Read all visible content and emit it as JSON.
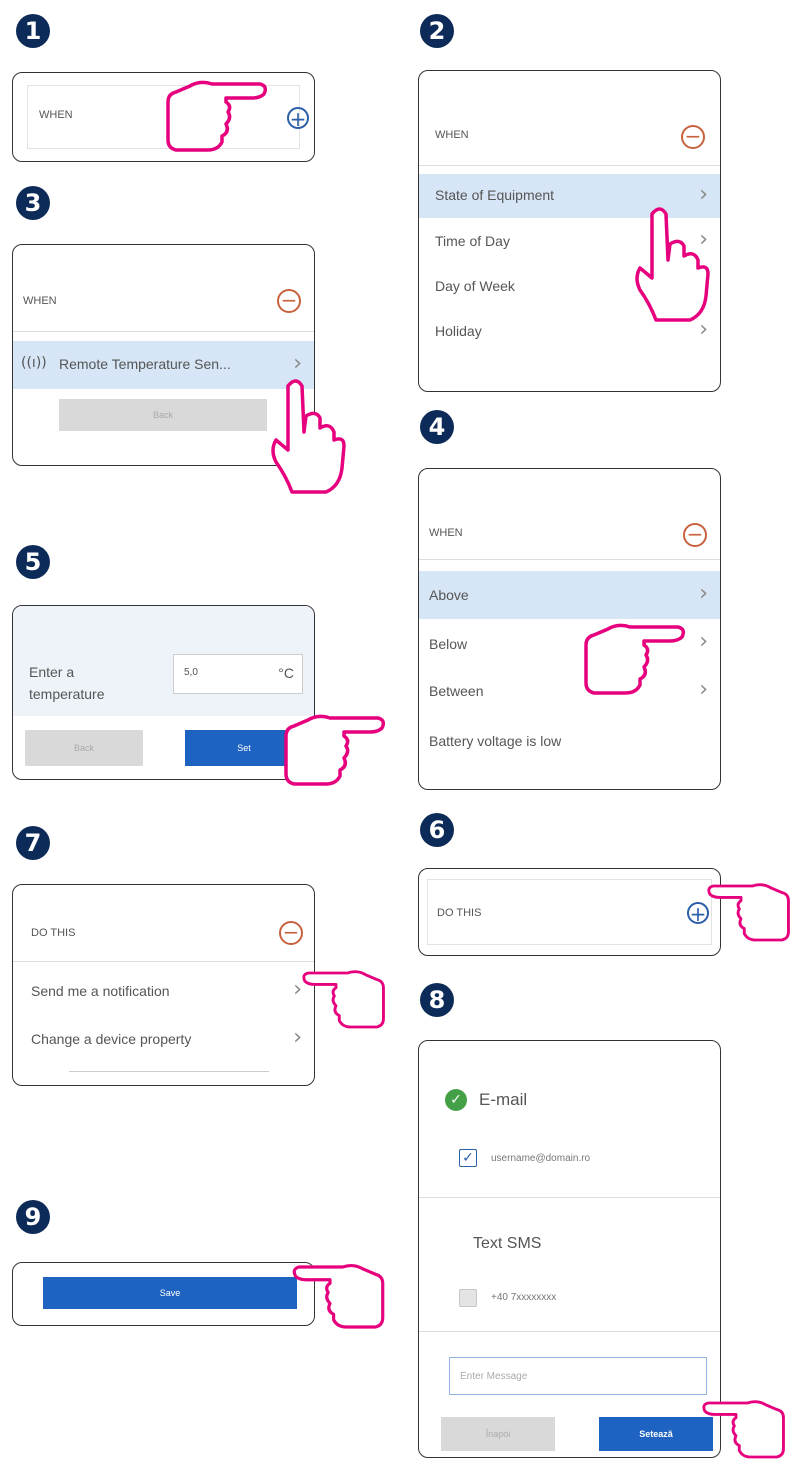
{
  "steps": [
    "1",
    "2",
    "3",
    "4",
    "5",
    "6",
    "7",
    "8",
    "9"
  ],
  "p1": {
    "when": "WHEN"
  },
  "p2": {
    "when": "WHEN",
    "items": [
      "State of Equipment",
      "Time of Day",
      "Day of Week",
      "Holiday"
    ]
  },
  "p3": {
    "when": "WHEN",
    "sensor": "Remote Temperature Sen...",
    "back": "Back"
  },
  "p4": {
    "when": "WHEN",
    "items": [
      "Above",
      "Below",
      "Between",
      "Battery voltage is low"
    ]
  },
  "p5": {
    "label_line1": "Enter a",
    "label_line2": "temperature",
    "value": "5,0",
    "unit": "°C",
    "back": "Back",
    "set": "Set"
  },
  "p6": {
    "do_this": "DO THIS"
  },
  "p7": {
    "do_this": "DO THIS",
    "items": [
      "Send me a notification",
      "Change a device property"
    ]
  },
  "p8": {
    "email_label": "E-mail",
    "email_value": "username@domain.ro",
    "sms_label": "Text SMS",
    "sms_value": "+40 7xxxxxxxx",
    "message_placeholder": "Enter Message",
    "back": "Înapoi",
    "set": "Setează"
  },
  "p9": {
    "save": "Save"
  },
  "colors": {
    "accent_blue": "#1e63c1",
    "highlight": "#d6e6f6",
    "hand_stroke": "#e6007e",
    "step_badge": "#0d2b58"
  }
}
